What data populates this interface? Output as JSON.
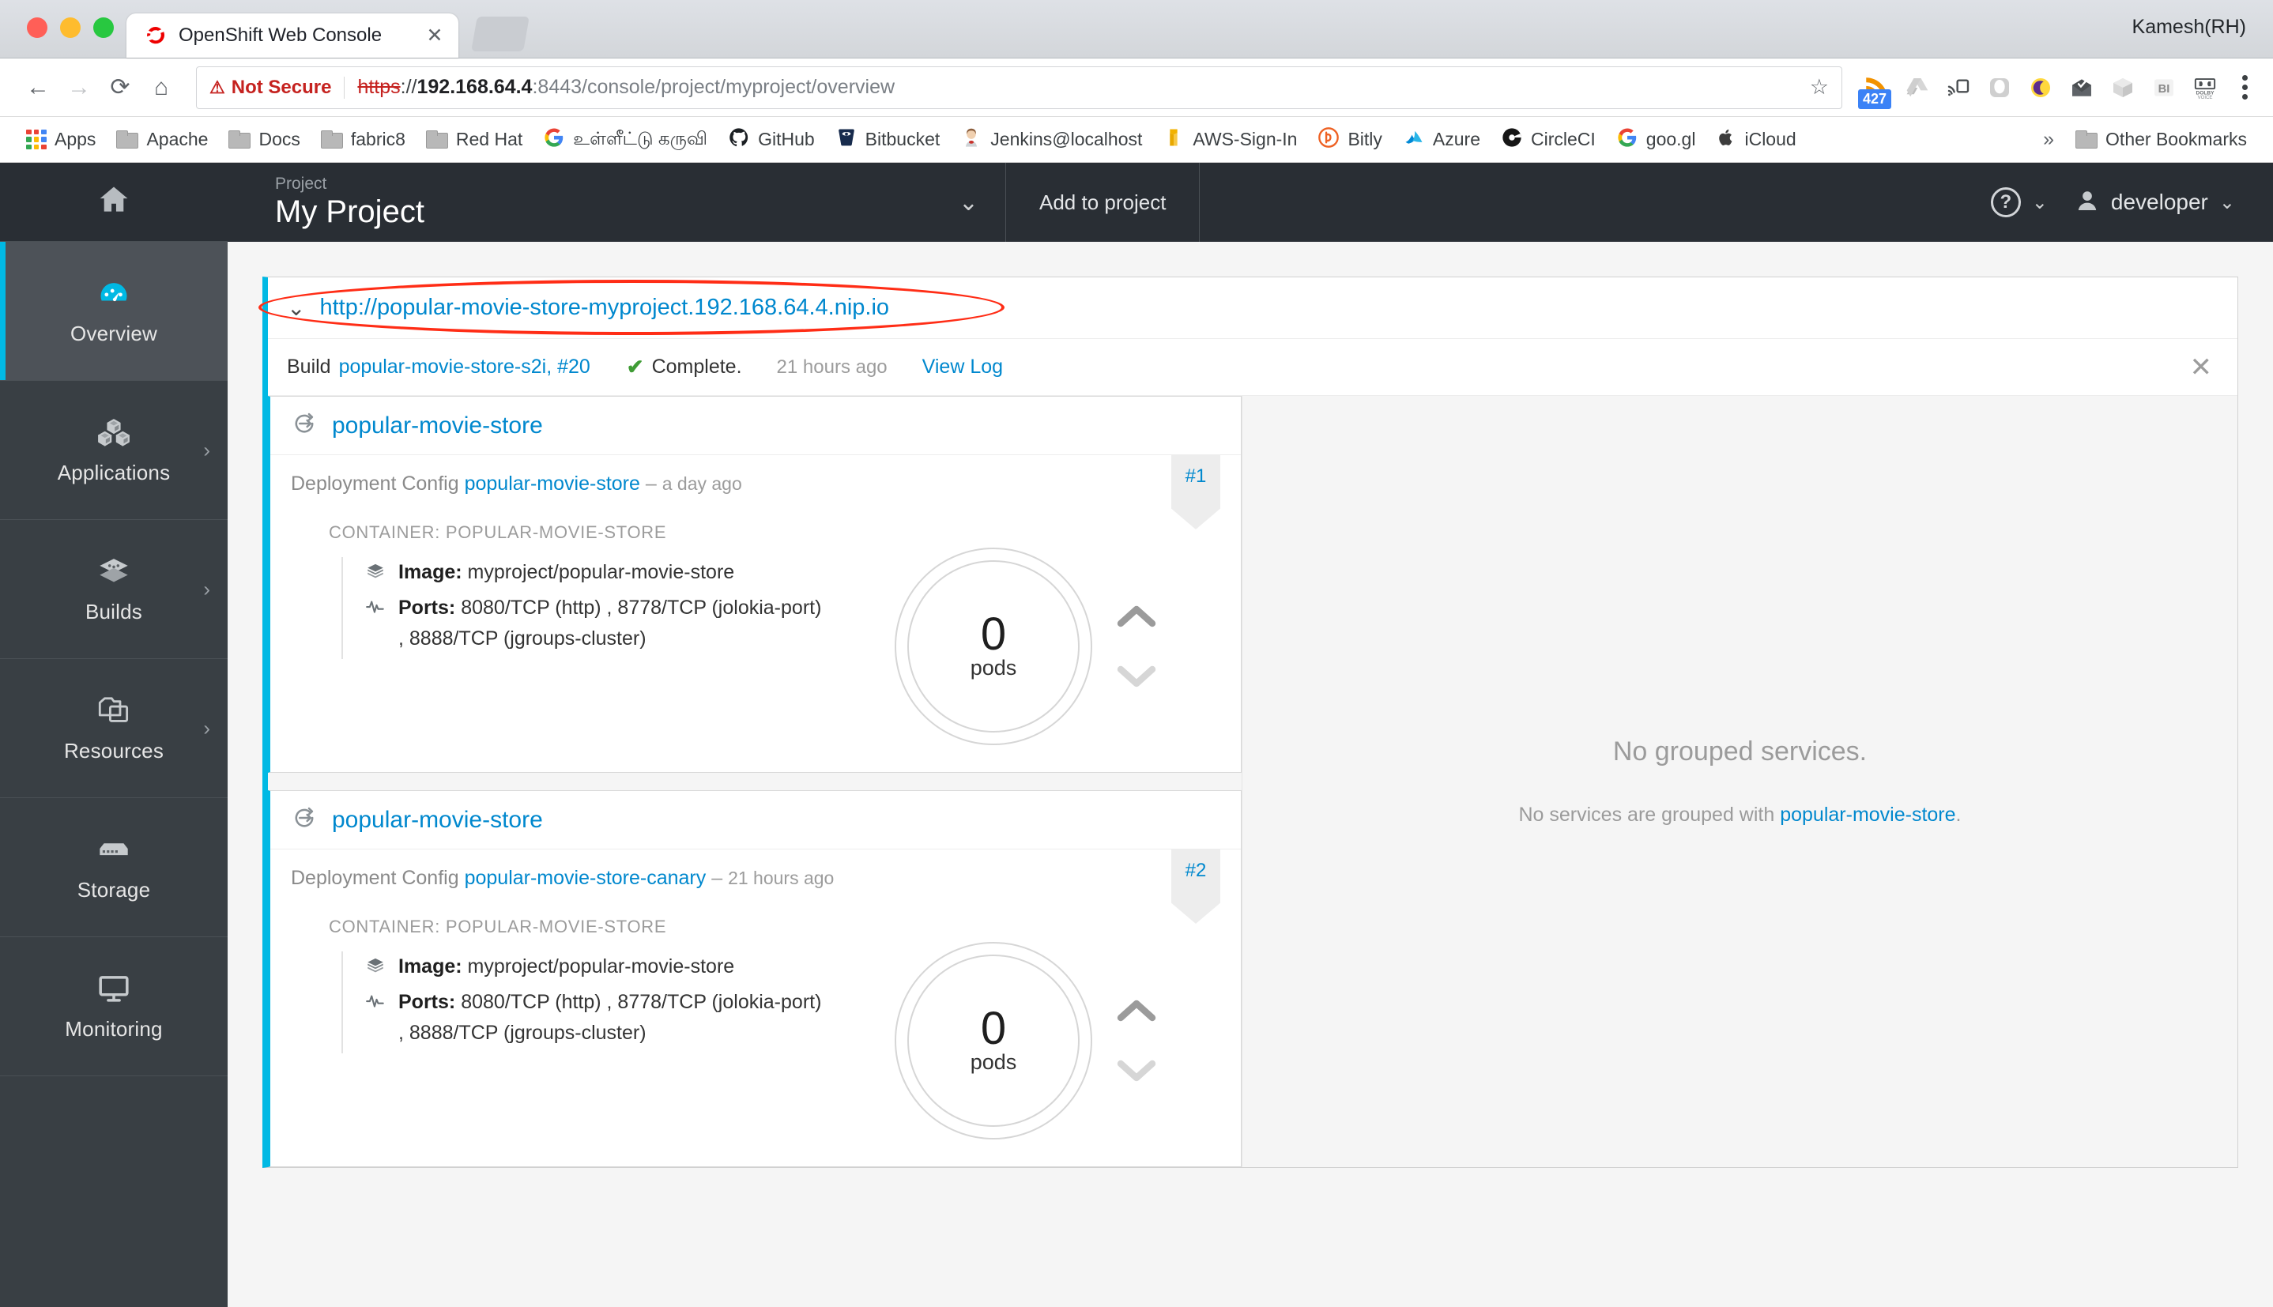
{
  "window": {
    "user_label": "Kamesh(RH)",
    "tab_title": "OpenShift Web Console",
    "tab_close": "✕"
  },
  "browser": {
    "back_icon": "←",
    "forward_icon": "→",
    "reload_icon": "⟳",
    "home_icon": "⌂",
    "security_warning": "Not Secure",
    "warning_icon": "⚠",
    "url": {
      "scheme": "https",
      "separator": "://",
      "host": "192.168.64.4",
      "rest": ":8443/console/project/myproject/overview"
    },
    "star_icon": "☆",
    "extension_badge": "427",
    "extensions": [
      "rss-feed-icon",
      "google-drive-icon",
      "cast-icon",
      "pocket-icon",
      "night-mode-icon",
      "mail-check-icon",
      "box-icon",
      "bluejeans-icon",
      "dolby-voice-icon"
    ]
  },
  "bookmarks": {
    "items": [
      {
        "label": "Apps",
        "icon": "apps-grid-icon"
      },
      {
        "label": "Apache",
        "icon": "folder-icon"
      },
      {
        "label": "Docs",
        "icon": "folder-icon"
      },
      {
        "label": "fabric8",
        "icon": "folder-icon"
      },
      {
        "label": "Red Hat",
        "icon": "folder-icon"
      },
      {
        "label": "உள்ளீட்டு கருவி",
        "icon": "google-icon"
      },
      {
        "label": "GitHub",
        "icon": "github-icon"
      },
      {
        "label": "Bitbucket",
        "icon": "bitbucket-icon"
      },
      {
        "label": "Jenkins@localhost",
        "icon": "jenkins-icon"
      },
      {
        "label": "AWS-Sign-In",
        "icon": "aws-icon"
      },
      {
        "label": "Bitly",
        "icon": "bitly-icon"
      },
      {
        "label": "Azure",
        "icon": "azure-icon"
      },
      {
        "label": "CircleCI",
        "icon": "circleci-icon"
      },
      {
        "label": "goo.gl",
        "icon": "google-icon"
      },
      {
        "label": "iCloud",
        "icon": "apple-icon"
      }
    ],
    "overflow_icon": "»",
    "other_bookmarks": "Other Bookmarks"
  },
  "sidebar": {
    "home_icon": "home-icon",
    "items": [
      {
        "label": "Overview",
        "icon": "dashboard-icon",
        "active": true,
        "has_caret": false
      },
      {
        "label": "Applications",
        "icon": "cubes-icon",
        "active": false,
        "has_caret": true
      },
      {
        "label": "Builds",
        "icon": "layers-icon",
        "active": false,
        "has_caret": true
      },
      {
        "label": "Resources",
        "icon": "files-icon",
        "active": false,
        "has_caret": true
      },
      {
        "label": "Storage",
        "icon": "database-icon",
        "active": false,
        "has_caret": false
      },
      {
        "label": "Monitoring",
        "icon": "monitor-icon",
        "active": false,
        "has_caret": false
      }
    ],
    "caret": "›"
  },
  "topnav": {
    "project_kicker": "Project",
    "project_name": "My Project",
    "project_caret": "⌄",
    "add_to_project": "Add to project",
    "help_glyph": "?",
    "help_caret": "⌄",
    "user_name": "developer",
    "user_caret": "⌄",
    "user_icon": "user-avatar-icon"
  },
  "overview": {
    "route": {
      "caret": "⌄",
      "url": "http://popular-movie-store-myproject.192.168.64.4.nip.io",
      "annotated": true,
      "annotation_color": "#ff2d16"
    },
    "build": {
      "prefix": "Build",
      "name": "popular-movie-store-s2i, #20",
      "check_icon": "✔",
      "status": "Complete.",
      "time": "21 hours ago",
      "view_log": "View Log",
      "close_icon": "✕"
    },
    "deployments": [
      {
        "title": "popular-movie-store",
        "icon": "deployment-config-icon",
        "config_label": "Deployment Config",
        "config_name": "popular-movie-store",
        "dash": "–",
        "age": "a day ago",
        "ribbon": "#1",
        "container_label": "CONTAINER: POPULAR-MOVIE-STORE",
        "image_label": "Image:",
        "image_value": "myproject/popular-movie-store",
        "ports_label": "Ports:",
        "ports_value": "8080/TCP (http) , 8778/TCP (jolokia-port) , 8888/TCP (jgroups-cluster)",
        "pod_count": "0",
        "pod_unit": "pods"
      },
      {
        "title": "popular-movie-store",
        "icon": "deployment-config-icon",
        "config_label": "Deployment Config",
        "config_name": "popular-movie-store-canary",
        "dash": "–",
        "age": "21 hours ago",
        "ribbon": "#2",
        "container_label": "CONTAINER: POPULAR-MOVIE-STORE",
        "image_label": "Image:",
        "image_value": "myproject/popular-movie-store",
        "ports_label": "Ports:",
        "ports_value": "8080/TCP (http) , 8778/TCP (jolokia-port) , 8888/TCP (jgroups-cluster)",
        "pod_count": "0",
        "pod_unit": "pods"
      }
    ],
    "no_grouped": {
      "title": "No grouped services.",
      "subtitle_prefix": "No services are grouped with ",
      "subtitle_link": "popular-movie-store",
      "subtitle_suffix": "."
    }
  },
  "colors": {
    "accent_blue": "#00b9e4",
    "link_blue": "#0088ce",
    "success_green": "#3f9c35",
    "annotation_red": "#ff2d16",
    "nav_dark": "#292e34",
    "sidebar_dark": "#393f44"
  }
}
